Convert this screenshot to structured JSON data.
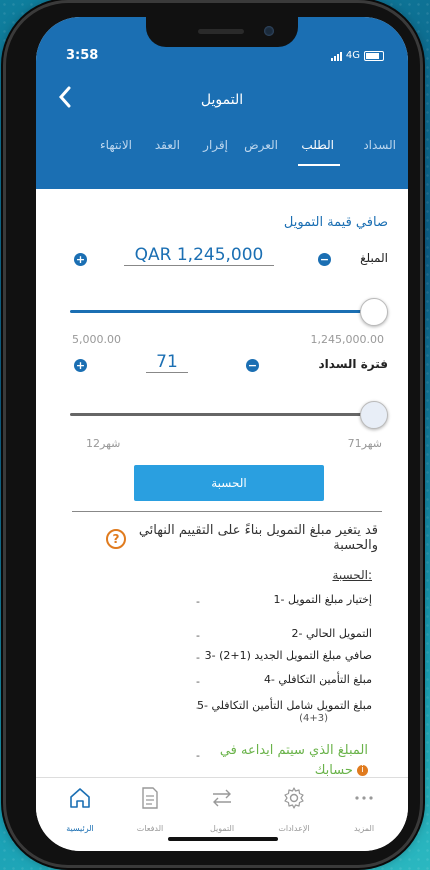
{
  "status": {
    "time": "3:58",
    "network": "4G"
  },
  "header": {
    "title": "التمويل"
  },
  "tabs": [
    "السداد",
    "الطلب",
    "العرض",
    "إقرار",
    "العقد",
    "الانتهاء"
  ],
  "active_tab": "الطلب",
  "financing": {
    "section_title": "صافي قيمة التمويل",
    "amount_label": "المبلغ",
    "amount_value": "QAR 1,245,000",
    "amount_min": "5,000.00",
    "amount_max": "1,245,000.00",
    "amount_level": 1.0,
    "period_label": "فترة السداد",
    "period_value": "71",
    "period_min": "12شهر",
    "period_max": "71شهر",
    "period_level": 1.0,
    "calc_button": "الحسبة"
  },
  "notice": "قد يتغير مبلغ التمويل بناءً على التقييم النهائي والحسبة",
  "calc": {
    "heading": "الحسبة:",
    "rows": [
      {
        "label": "1- إختيار مبلغ التمويل",
        "value": "-"
      },
      {
        "label": "2- التمويل الحالي",
        "value": "-"
      },
      {
        "label": "3- صافي مبلغ التمويل الجديد (1+2)",
        "value": "-"
      },
      {
        "label": "4- مبلغ التأمين التكافلي",
        "value": "-"
      },
      {
        "label": "5- مبلغ التمويل شامل التأمين التكافلي",
        "value": "-"
      }
    ],
    "row5_sub": "(4+3)",
    "deposit": "المبلغ الذي سيتم ايداعه في حسابك"
  },
  "bottom_nav": [
    {
      "label": "الرئيسية",
      "icon": "home-icon"
    },
    {
      "label": "الدفعات",
      "icon": "document-icon"
    },
    {
      "label": "التمويل",
      "icon": "transfer-icon"
    },
    {
      "label": "الإعدادات",
      "icon": "gear-icon"
    },
    {
      "label": "المزيد",
      "icon": "more-icon"
    }
  ],
  "colors": {
    "brand": "#1b6fb3",
    "accent_button": "#2a9fe0",
    "deposit_text": "#6ab34a",
    "warning": "#e07b1e"
  }
}
